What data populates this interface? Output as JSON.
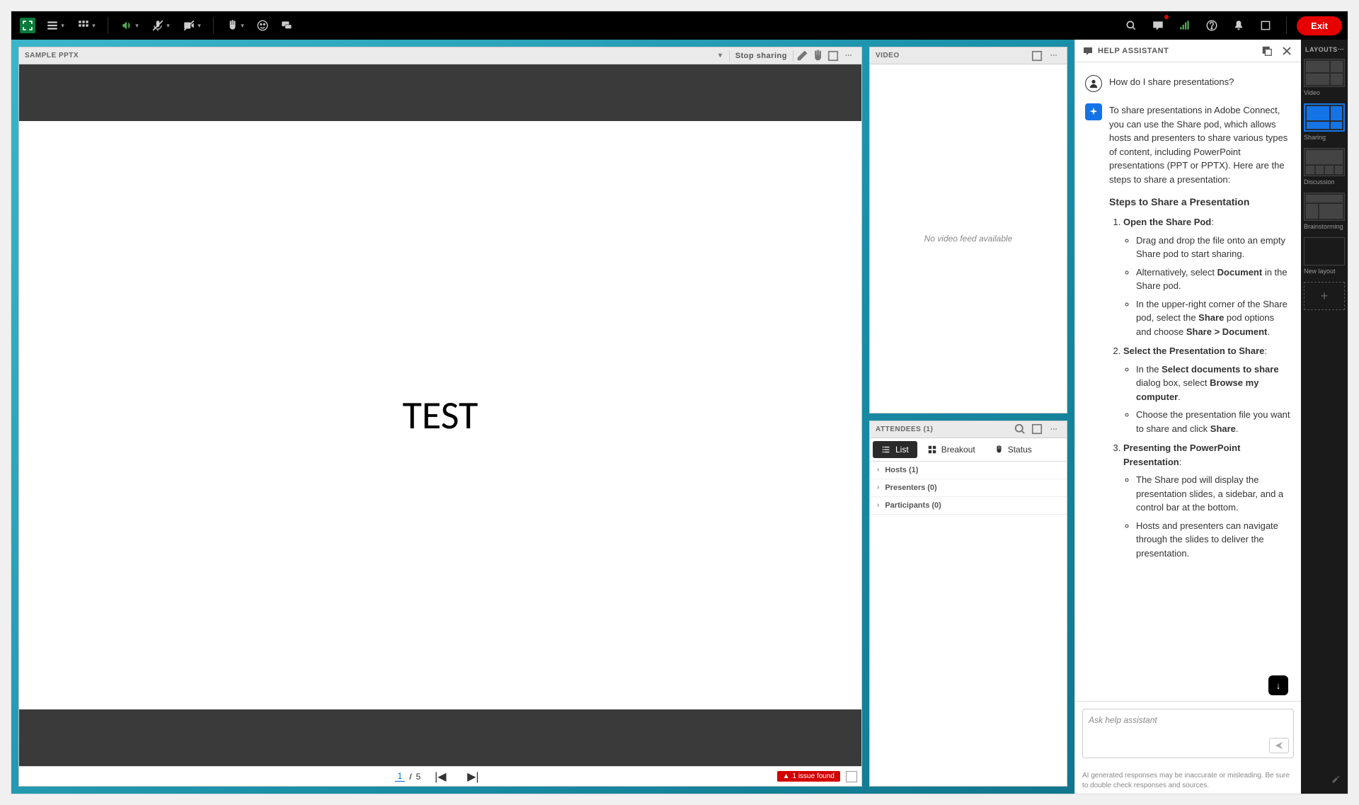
{
  "toolbar": {
    "exit_label": "Exit"
  },
  "share_pod": {
    "title": "SAMPLE PPTX",
    "stop_sharing": "Stop sharing",
    "slide_text": "TEST",
    "page_current": "1",
    "page_sep": "/",
    "page_total": "5",
    "issue_text": "1 issue found"
  },
  "video_pod": {
    "title": "VIDEO",
    "empty": "No video feed available"
  },
  "attendees_pod": {
    "title": "ATTENDEES  (1)",
    "tabs": {
      "list": "List",
      "breakout": "Breakout",
      "status": "Status"
    },
    "groups": {
      "hosts": "Hosts (1)",
      "presenters": "Presenters (0)",
      "participants": "Participants (0)"
    }
  },
  "help": {
    "title": "HELP ASSISTANT",
    "user_question": "How do I share presentations?",
    "intro": "To share presentations in Adobe Connect, you can use the Share pod, which allows hosts and presenters to share various types of content, including PowerPoint presentations (PPT or PPTX). Here are the steps to share a presentation:",
    "steps_heading": "Steps to Share a Presentation",
    "step1_title": "Open the Share Pod",
    "step1_a": "Drag and drop the file onto an empty Share pod to start sharing.",
    "step1_b_pre": "Alternatively, select ",
    "step1_b_bold": "Document",
    "step1_b_post": " in the Share pod.",
    "step1_c_pre": "In the upper-right corner of the Share pod, select the ",
    "step1_c_bold1": "Share",
    "step1_c_mid": " pod options and choose ",
    "step1_c_bold2": "Share > Document",
    "step1_c_post": ".",
    "step2_title": "Select the Presentation to Share",
    "step2_a_pre": "In the ",
    "step2_a_bold1": "Select documents to share",
    "step2_a_mid": " dialog box, select ",
    "step2_a_bold2": "Browse my computer",
    "step2_a_post": ".",
    "step2_b_pre": "Choose the presentation file you want to share and click ",
    "step2_b_bold": "Share",
    "step2_b_post": ".",
    "step3_title": "Presenting the PowerPoint Presentation",
    "step3_a": "The Share pod will display the presentation slides, a sidebar, and a control bar at the bottom.",
    "step3_b": "Hosts and presenters can navigate through the slides to deliver the presentation.",
    "placeholder": "Ask help assistant",
    "disclaimer": "AI generated responses may be inaccurate or misleading. Be sure to double check responses and sources."
  },
  "layouts": {
    "title": "LAYOUTS",
    "items": [
      "Video",
      "Sharing",
      "Discussion",
      "Brainstorming",
      "New layout"
    ]
  }
}
